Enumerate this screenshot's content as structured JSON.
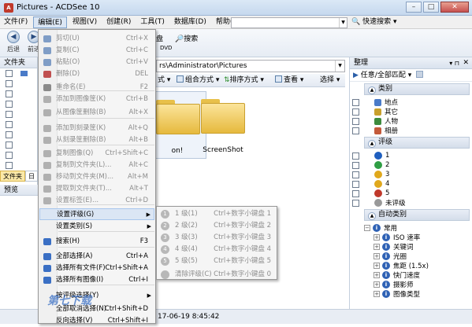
{
  "window": {
    "title": "Pictures - ACDSee 10",
    "app_icon": "acdsee-app-icon"
  },
  "menubar": {
    "items": [
      "文件(F)",
      "编辑(E)",
      "视图(V)",
      "创建(R)",
      "工具(T)",
      "数据库(D)",
      "帮助(H)"
    ]
  },
  "search": {
    "placeholder": "",
    "quick_search_label": "快速搜索"
  },
  "toolbar": {
    "back_label": "后退",
    "forward_label": "前进",
    "disc_label": "盘",
    "search_label": "搜索",
    "dvd_label": "DVD"
  },
  "left_panel": {
    "header": "文件夹",
    "tab_folders": "文件夹",
    "tab_other": "日",
    "preview_header": "预览"
  },
  "address": {
    "value": "rs\\Administrator\\Pictures"
  },
  "viewbar": {
    "display_mode": "式",
    "group_mode": "组合方式",
    "sort_mode": "排序方式",
    "view_label": "查看",
    "select_label": "选择"
  },
  "content": {
    "thumbs": [
      {
        "label": "on!"
      },
      {
        "label": "ScreenShot"
      }
    ]
  },
  "right_panel": {
    "header": "整理",
    "filter_label": "任意/全部匹配",
    "category_header": "类别",
    "categories": [
      "地点",
      "其它",
      "人物",
      "相册"
    ],
    "rating_header": "评级",
    "ratings": [
      "1",
      "2",
      "3",
      "4",
      "5",
      "未评级"
    ],
    "auto_header": "自动类别",
    "auto_root": "常用",
    "auto_items": [
      "ISO 速率",
      "关键词",
      "光圈",
      "焦距 (1.5x)",
      "快门速度",
      "摄影师",
      "图像类型"
    ]
  },
  "statusbar": {
    "timestamp": "17-06-19 8:45:42"
  },
  "edit_menu": {
    "items": [
      {
        "label": "剪切(U)",
        "shortcut": "Ctrl+X",
        "disabled": true
      },
      {
        "label": "复制(C)",
        "shortcut": "Ctrl+C",
        "disabled": true
      },
      {
        "label": "粘贴(O)",
        "shortcut": "Ctrl+V",
        "disabled": true
      },
      {
        "label": "删除(D)",
        "shortcut": "DEL",
        "disabled": true
      },
      {
        "label": "重命名(E)",
        "shortcut": "F2",
        "disabled": true
      },
      {
        "label": "添加到图像筐(K)",
        "shortcut": "Ctrl+B",
        "disabled": true
      },
      {
        "label": "从图像筐删除(B)",
        "shortcut": "Alt+X",
        "disabled": true
      },
      {
        "label": "添加到刻录筐(K)",
        "shortcut": "Alt+Q",
        "disabled": true
      },
      {
        "label": "从刻录筐删除(B)",
        "shortcut": "Alt+B",
        "disabled": true
      },
      {
        "label": "复制图像(Q)",
        "shortcut": "Ctrl+Shift+C",
        "disabled": true
      },
      {
        "label": "复制到文件夹(L)...",
        "shortcut": "Alt+C",
        "disabled": true
      },
      {
        "label": "移动到文件夹(M)...",
        "shortcut": "Alt+M",
        "disabled": true
      },
      {
        "label": "提取到文件夹(T)...",
        "shortcut": "Alt+T",
        "disabled": true
      },
      {
        "label": "设置标签(E)...",
        "shortcut": "Ctrl+D",
        "disabled": true
      },
      {
        "label": "设置评级(G)",
        "shortcut": "",
        "disabled": false
      },
      {
        "label": "设置类别(S)",
        "shortcut": "",
        "disabled": false
      },
      {
        "label": "搜索(H)",
        "shortcut": "F3",
        "disabled": false
      },
      {
        "label": "全部选择(A)",
        "shortcut": "Ctrl+A",
        "disabled": false
      },
      {
        "label": "选择所有文件(F)",
        "shortcut": "Ctrl+Shift+A",
        "disabled": false
      },
      {
        "label": "选择所有图像(I)",
        "shortcut": "Ctrl+I",
        "disabled": false
      },
      {
        "label": "按评级选择(Y)",
        "shortcut": "",
        "disabled": false
      },
      {
        "label": "全部取消选择(N)",
        "shortcut": "Ctrl+Shift+D",
        "disabled": false
      },
      {
        "label": "反向选择(V)",
        "shortcut": "Ctrl+Shift+I",
        "disabled": false
      }
    ]
  },
  "rating_submenu": {
    "items": [
      {
        "num": "1",
        "label": "1 级(1)",
        "shortcut": "Ctrl+数字小键盘 1"
      },
      {
        "num": "2",
        "label": "2 级(2)",
        "shortcut": "Ctrl+数字小键盘 2"
      },
      {
        "num": "3",
        "label": "3 级(3)",
        "shortcut": "Ctrl+数字小键盘 3"
      },
      {
        "num": "4",
        "label": "4 级(4)",
        "shortcut": "Ctrl+数字小键盘 4"
      },
      {
        "num": "5",
        "label": "5 级(5)",
        "shortcut": "Ctrl+数字小键盘 5"
      },
      {
        "num": "",
        "label": "清除评级(C)",
        "shortcut": "Ctrl+数字小键盘 0"
      }
    ]
  },
  "watermark": {
    "text": "第七下载"
  },
  "colors": {
    "category_icons": [
      "#4a7bc8",
      "#c9a02c",
      "#3d8b3d",
      "#c45a3a"
    ],
    "rating_icons": [
      "#1f5fbf",
      "#2f9e44",
      "#e0a81c",
      "#e0a81c",
      "#c0392b",
      "#999999"
    ]
  }
}
